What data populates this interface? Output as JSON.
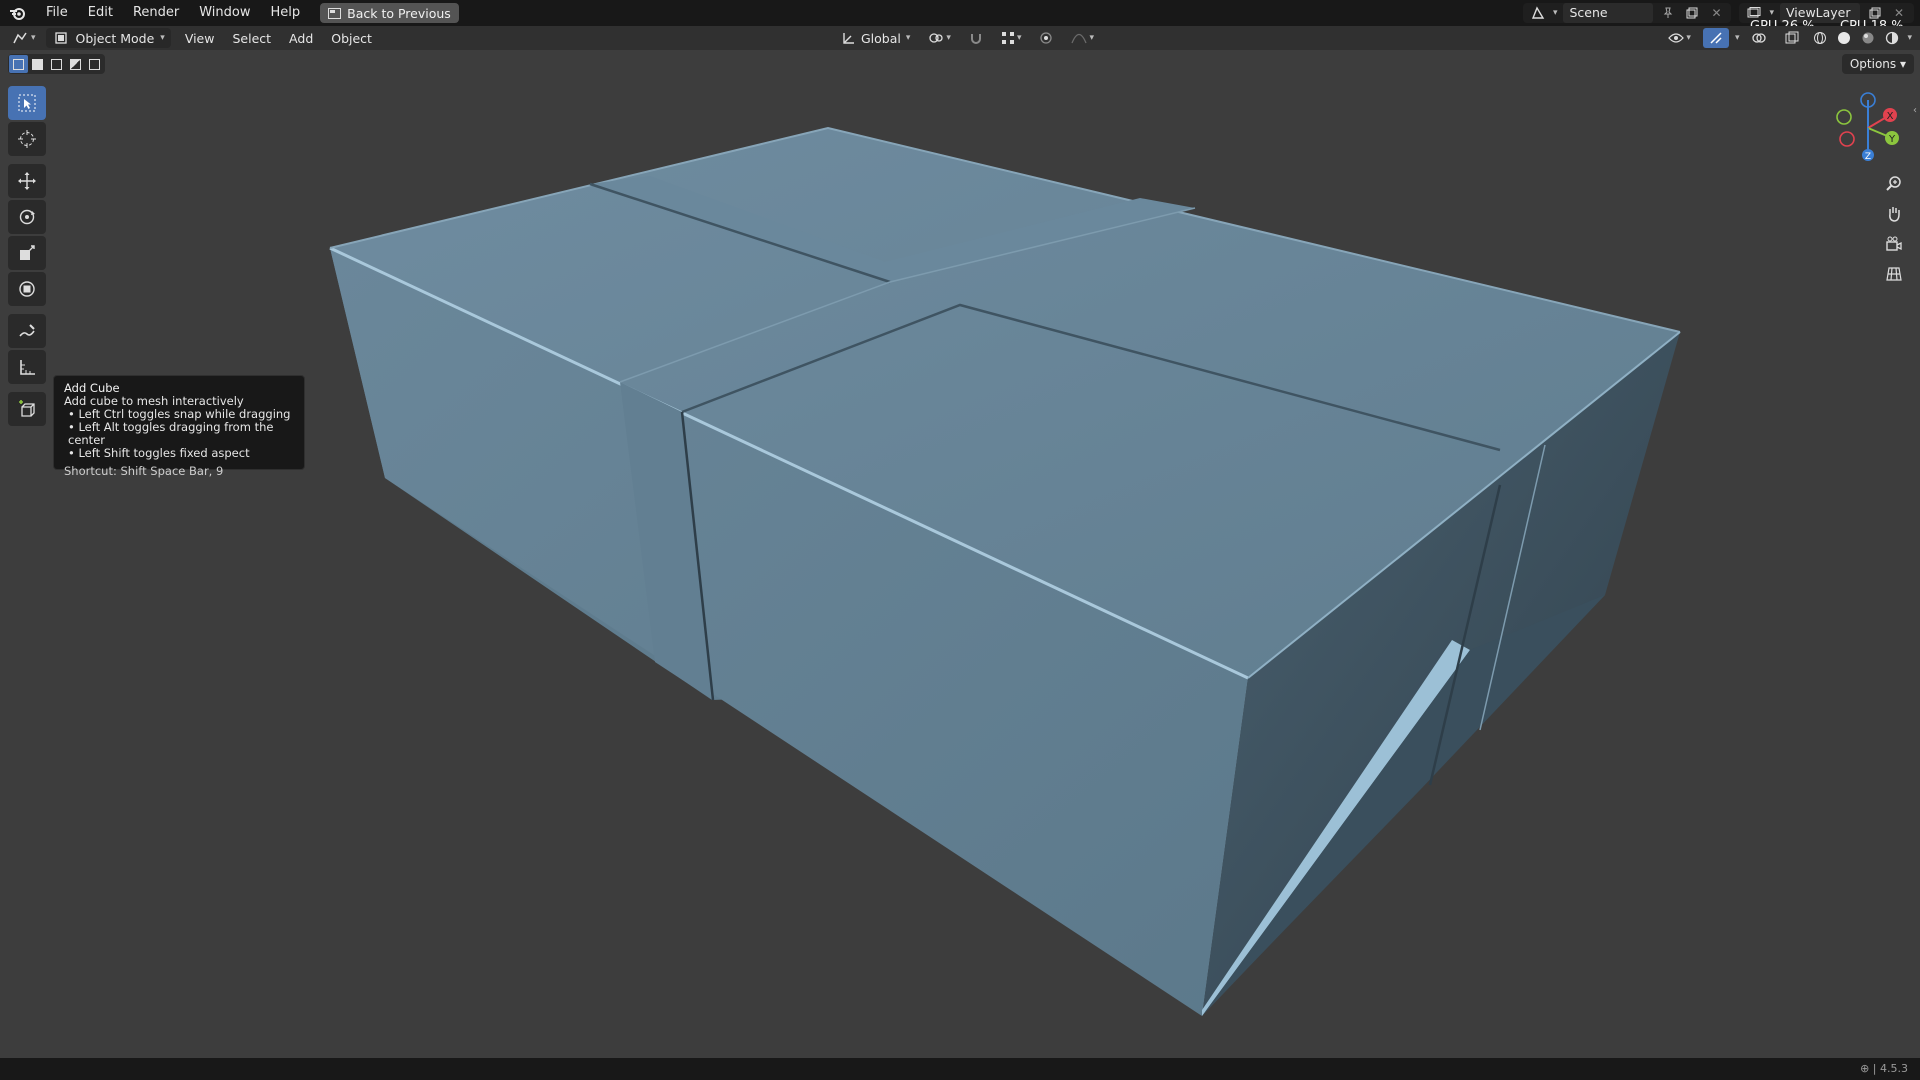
{
  "menu": {
    "items": [
      "File",
      "Edit",
      "Render",
      "Window",
      "Help"
    ],
    "back_button": "Back to Previous"
  },
  "scene": {
    "label": "Scene",
    "view_layer": "ViewLayer"
  },
  "stats": {
    "gpu": "GPU 26 %",
    "cpu": "CPU 18 %"
  },
  "header": {
    "mode": "Object Mode",
    "menus": [
      "View",
      "Select",
      "Add",
      "Object"
    ],
    "transform_orientation": "Global",
    "options": "Options"
  },
  "toolbar": {
    "tools": [
      "select-box",
      "cursor",
      "move",
      "rotate",
      "scale",
      "transform",
      "annotate",
      "measure",
      "add-cube"
    ],
    "active_tool": "select-box"
  },
  "tooltip": {
    "title": "Add Cube",
    "description": "Add cube to mesh interactively",
    "bullets": [
      "Left Ctrl toggles snap while dragging",
      "Left Alt toggles dragging from the center",
      "Left Shift toggles fixed aspect"
    ],
    "shortcut": "Shortcut: Shift Space Bar, 9"
  },
  "gizmo": {
    "axes": [
      "X",
      "Y",
      "Z"
    ]
  },
  "version": "4.5.3",
  "colors": {
    "viewport_bg": "#3d3d3d",
    "model": "#6b8799",
    "accent": "#4772b3",
    "axis_x": "#e2424f",
    "axis_y": "#8cc63e",
    "axis_z": "#3a7fd6"
  }
}
